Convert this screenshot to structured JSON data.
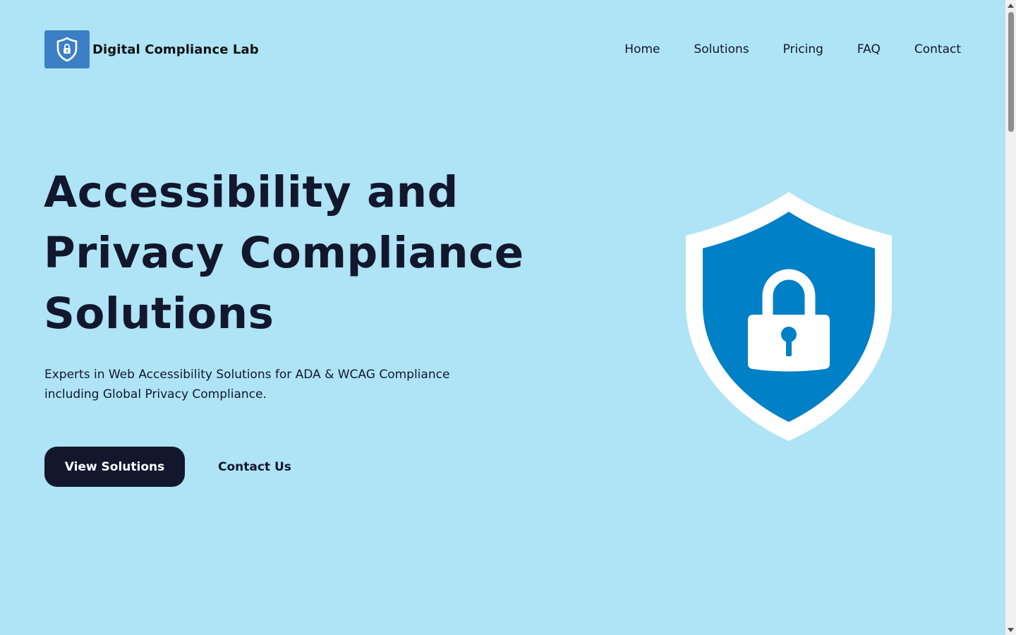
{
  "header": {
    "brand_name": "Digital Compliance Lab",
    "logo_icon": "shield-lock-icon",
    "nav": [
      {
        "label": "Home"
      },
      {
        "label": "Solutions"
      },
      {
        "label": "Pricing"
      },
      {
        "label": "FAQ"
      },
      {
        "label": "Contact"
      }
    ]
  },
  "hero": {
    "title_lines": [
      "Accessibility and",
      "Privacy Compliance",
      "Solutions"
    ],
    "subtitle_lines": [
      "Experts in Web Accessibility Solutions for ADA & WCAG Compliance",
      "including Global Privacy Compliance."
    ],
    "primary_button": "View Solutions",
    "secondary_button": "Contact Us",
    "illustration_icon": "shield-lock-icon"
  },
  "colors": {
    "background": "#aee4f5",
    "text_dark": "#12172e",
    "logo_bg": "#3b7fc4",
    "shield_blue": "#0080c6",
    "shield_border": "#ffffff",
    "button_bg": "#12172e",
    "button_text": "#ffffff"
  }
}
